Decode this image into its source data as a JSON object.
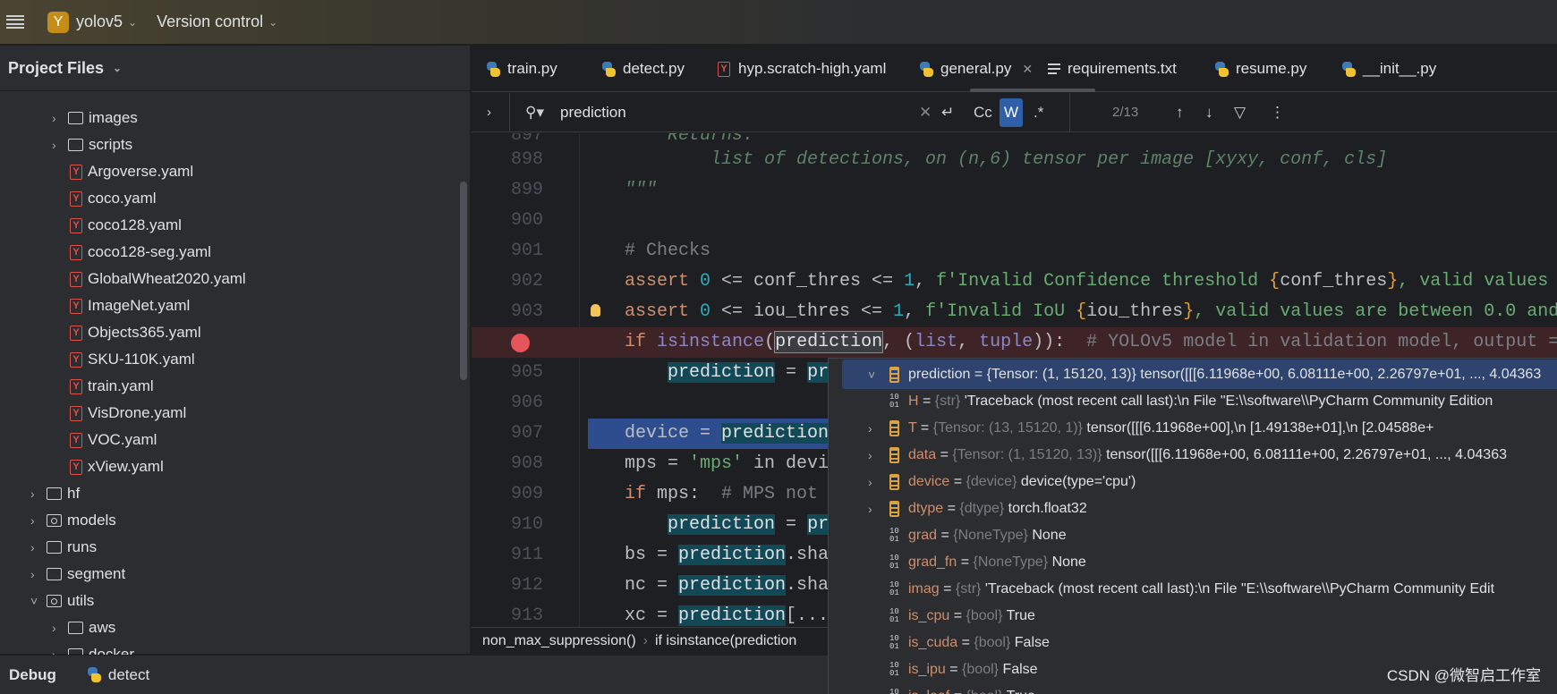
{
  "topbar": {
    "project_initial": "Y",
    "project": "yolov5",
    "vcs": "Version control"
  },
  "sidebar": {
    "title": "Project Files",
    "items": [
      {
        "label": "images",
        "kind": "folder",
        "depth": 3,
        "arrow": "right"
      },
      {
        "label": "scripts",
        "kind": "folder",
        "depth": 3,
        "arrow": "right"
      },
      {
        "label": "Argoverse.yaml",
        "kind": "yaml",
        "depth": 3
      },
      {
        "label": "coco.yaml",
        "kind": "yaml",
        "depth": 3
      },
      {
        "label": "coco128.yaml",
        "kind": "yaml",
        "depth": 3
      },
      {
        "label": "coco128-seg.yaml",
        "kind": "yaml",
        "depth": 3
      },
      {
        "label": "GlobalWheat2020.yaml",
        "kind": "yaml",
        "depth": 3
      },
      {
        "label": "ImageNet.yaml",
        "kind": "yaml",
        "depth": 3
      },
      {
        "label": "Objects365.yaml",
        "kind": "yaml",
        "depth": 3
      },
      {
        "label": "SKU-110K.yaml",
        "kind": "yaml",
        "depth": 3
      },
      {
        "label": "train.yaml",
        "kind": "yaml",
        "depth": 3
      },
      {
        "label": "VisDrone.yaml",
        "kind": "yaml",
        "depth": 3
      },
      {
        "label": "VOC.yaml",
        "kind": "yaml",
        "depth": 3
      },
      {
        "label": "xView.yaml",
        "kind": "yaml",
        "depth": 3
      },
      {
        "label": "hf",
        "kind": "folder",
        "depth": 2,
        "arrow": "right"
      },
      {
        "label": "models",
        "kind": "module",
        "depth": 2,
        "arrow": "right"
      },
      {
        "label": "runs",
        "kind": "folder",
        "depth": 2,
        "arrow": "right"
      },
      {
        "label": "segment",
        "kind": "folder",
        "depth": 2,
        "arrow": "right"
      },
      {
        "label": "utils",
        "kind": "module",
        "depth": 2,
        "arrow": "down"
      },
      {
        "label": "aws",
        "kind": "folder",
        "depth": 3,
        "arrow": "right"
      },
      {
        "label": "docker",
        "kind": "folder",
        "depth": 3,
        "arrow": "right"
      }
    ]
  },
  "tabs": [
    {
      "label": "train.py",
      "icon": "python"
    },
    {
      "label": "detect.py",
      "icon": "python"
    },
    {
      "label": "hyp.scratch-high.yaml",
      "icon": "yaml"
    },
    {
      "label": "general.py",
      "icon": "python",
      "active": true
    },
    {
      "label": "requirements.txt",
      "icon": "text"
    },
    {
      "label": "resume.py",
      "icon": "python"
    },
    {
      "label": "__init__.py",
      "icon": "python"
    }
  ],
  "find": {
    "query": "prediction",
    "match_case": "Cc",
    "words": "W",
    "regex": ".*",
    "count": "2/13",
    "words_enabled": true
  },
  "editor": {
    "lines": [
      {
        "n": "898",
        "seg": [
          [
            "        list of detections, on (n,6) tensor per image [xyxy, conf, cls]",
            "doc"
          ]
        ]
      },
      {
        "n": "899",
        "seg": [
          [
            "\"\"\"",
            "doc"
          ]
        ]
      },
      {
        "n": "900",
        "seg": []
      },
      {
        "n": "901",
        "seg": [
          [
            "# Checks",
            "cm"
          ]
        ]
      },
      {
        "n": "902",
        "seg": [
          [
            "assert ",
            "kw"
          ],
          [
            "0",
            "num"
          ],
          [
            " <= conf_thres <= ",
            "plain"
          ],
          [
            "1",
            "num"
          ],
          [
            ", ",
            "plain"
          ],
          [
            "f'Invalid Confidence threshold ",
            "str"
          ],
          [
            "{",
            "br"
          ],
          [
            "conf_thres",
            "plain"
          ],
          [
            "}",
            "br"
          ],
          [
            ", valid values",
            "str"
          ]
        ]
      },
      {
        "n": "903",
        "bulb": true,
        "seg": [
          [
            "assert ",
            "kw"
          ],
          [
            "0",
            "num"
          ],
          [
            " <= iou_thres <= ",
            "plain"
          ],
          [
            "1",
            "num"
          ],
          [
            ", ",
            "plain"
          ],
          [
            "f'Invalid IoU ",
            "str"
          ],
          [
            "{",
            "br"
          ],
          [
            "iou_thres",
            "plain"
          ],
          [
            "}",
            "br"
          ],
          [
            ", valid values are between 0.0 and",
            "str"
          ]
        ]
      },
      {
        "n": "",
        "breakpoint": true,
        "row": "bp",
        "seg": [
          [
            "if ",
            "kw"
          ],
          [
            "isinstance",
            "bi"
          ],
          [
            "(",
            "plain"
          ],
          [
            "prediction",
            "box"
          ],
          [
            ", (",
            "plain"
          ],
          [
            "list",
            "bi"
          ],
          [
            ", ",
            "plain"
          ],
          [
            "tuple",
            "bi"
          ],
          [
            ")):  ",
            "plain"
          ],
          [
            "# YOLOv5 model in validation model, output =",
            "cm"
          ]
        ]
      },
      {
        "n": "905",
        "seg": [
          [
            "    ",
            "plain"
          ],
          [
            "prediction",
            "hl"
          ],
          [
            " = ",
            "plain"
          ],
          [
            "pr",
            "hl"
          ]
        ]
      },
      {
        "n": "906",
        "seg": []
      },
      {
        "n": "907",
        "row": "exec",
        "seg": [
          [
            "device = ",
            "plain"
          ],
          [
            "prediction",
            "hl"
          ]
        ]
      },
      {
        "n": "908",
        "seg": [
          [
            "mps = ",
            "plain"
          ],
          [
            "'mps'",
            "str"
          ],
          [
            " in devi",
            "plain"
          ]
        ]
      },
      {
        "n": "909",
        "seg": [
          [
            "if ",
            "kw"
          ],
          [
            "mps:  ",
            "plain"
          ],
          [
            "# MPS not",
            "cm"
          ]
        ]
      },
      {
        "n": "910",
        "seg": [
          [
            "    ",
            "plain"
          ],
          [
            "prediction",
            "hl"
          ],
          [
            " = ",
            "plain"
          ],
          [
            "pr",
            "hl"
          ]
        ]
      },
      {
        "n": "911",
        "seg": [
          [
            "bs = ",
            "plain"
          ],
          [
            "prediction",
            "hl"
          ],
          [
            ".sha",
            "plain"
          ]
        ]
      },
      {
        "n": "912",
        "seg": [
          [
            "nc = ",
            "plain"
          ],
          [
            "prediction",
            "hl"
          ],
          [
            ".sha",
            "plain"
          ]
        ]
      },
      {
        "n": "913",
        "seg": [
          [
            "xc = ",
            "plain"
          ],
          [
            "prediction",
            "hl"
          ],
          [
            "[...",
            "plain"
          ]
        ]
      }
    ]
  },
  "breadcrumb": [
    "non_max_suppression()",
    "if isinstance(prediction"
  ],
  "debug": {
    "label": "Debug",
    "config": "detect"
  },
  "popup": {
    "rows": [
      {
        "name": "prediction",
        "type": "{Tensor: (1, 15120, 13)}",
        "value": "tensor([[[6.11968e+00, 6.08111e+00, 2.26797e+01,  ..., 4.04363",
        "icon": "tensor",
        "arrow": "down",
        "selected": true
      },
      {
        "name": "H",
        "type": "{str}",
        "value": "'Traceback (most recent call last):\\n  File \"E:\\\\software\\\\PyCharm Community Edition",
        "icon": "primitive"
      },
      {
        "name": "T",
        "type": "{Tensor: (13, 15120, 1)}",
        "value": "tensor([[[6.11968e+00],\\n         [1.49138e+01],\\n         [2.04588e+",
        "icon": "tensor",
        "arrow": "right"
      },
      {
        "name": "data",
        "type": "{Tensor: (1, 15120, 13)}",
        "value": "tensor([[[6.11968e+00, 6.08111e+00, 2.26797e+01,  ..., 4.04363",
        "icon": "tensor",
        "arrow": "right"
      },
      {
        "name": "device",
        "type": "{device}",
        "value": "device(type='cpu')",
        "icon": "tensor",
        "arrow": "right"
      },
      {
        "name": "dtype",
        "type": "{dtype}",
        "value": "torch.float32",
        "icon": "tensor",
        "arrow": "right"
      },
      {
        "name": "grad",
        "type": "{NoneType}",
        "value": "None",
        "icon": "primitive"
      },
      {
        "name": "grad_fn",
        "type": "{NoneType}",
        "value": "None",
        "icon": "primitive"
      },
      {
        "name": "imag",
        "type": "{str}",
        "value": "'Traceback (most recent call last):\\n  File \"E:\\\\software\\\\PyCharm Community Edit",
        "icon": "primitive"
      },
      {
        "name": "is_cpu",
        "type": "{bool}",
        "value": "True",
        "icon": "primitive"
      },
      {
        "name": "is_cuda",
        "type": "{bool}",
        "value": "False",
        "icon": "primitive"
      },
      {
        "name": "is_ipu",
        "type": "{bool}",
        "value": "False",
        "icon": "primitive"
      },
      {
        "name": "is_leaf",
        "type": "{bool}",
        "value": "True",
        "icon": "primitive"
      }
    ]
  },
  "watermark": "CSDN @微智启工作室"
}
